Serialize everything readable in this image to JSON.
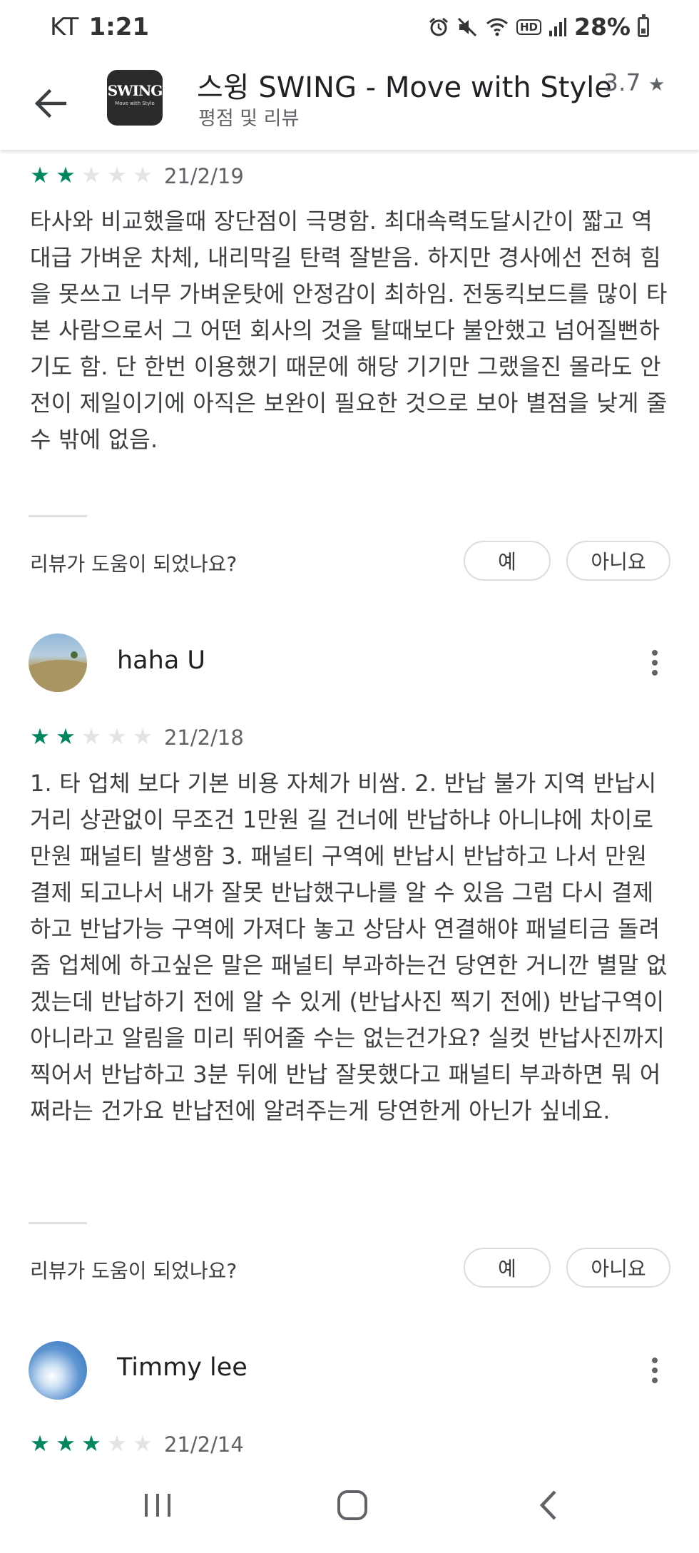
{
  "status_bar": {
    "carrier": "KT",
    "time": "1:21",
    "icons": [
      "alarm-icon",
      "mute-icon",
      "wifi-icon",
      "hd-icon",
      "signal-icon",
      "battery-icon"
    ],
    "hd_label": "HD",
    "battery": "28%"
  },
  "header": {
    "logo_text": "SWING",
    "logo_tagline": "Move with Style",
    "app_title": "스윙 SWING - Move with Style",
    "rating": "3.7",
    "subtitle": "평점 및 리뷰"
  },
  "accent_color": "#01875f",
  "reviews": [
    {
      "rating": 2,
      "date": "21/2/19",
      "text": "타사와 비교했을때 장단점이 극명함. 최대속력도달시간이 짧고 역대급 가벼운 차체, 내리막길 탄력 잘받음. 하지만 경사에선 전혀 힘을 못쓰고 너무 가벼운탓에 안정감이 최하임. 전동킥보드를 많이 타본 사람으로서 그 어떤 회사의 것을 탈때보다 불안했고 넘어질뻔하기도 함. 단 한번 이용했기 때문에 해당 기기만 그랬을진 몰라도 안전이 제일이기에 아직은 보완이 필요한 것으로 보아 별점을 낮게 줄 수 밖에 없음.",
      "helpful_question": "리뷰가 도움이 되었나요?",
      "yes_label": "예",
      "no_label": "아니요"
    },
    {
      "author": "haha U",
      "rating": 2,
      "date": "21/2/18",
      "text": "1. 타 업체 보다 기본 비용 자체가 비쌈. 2. 반납 불가 지역 반납시 거리 상관없이 무조건 1만원 길 건너에 반납하냐 아니냐에 차이로 만원 패널티 발생함 3. 패널티 구역에 반납시 반납하고 나서 만원 결제 되고나서 내가 잘못 반납했구나를 알 수 있음 그럼 다시 결제하고 반납가능 구역에 가져다 놓고 상담사 연결해야 패널티금 돌려줌 업체에 하고싶은 말은 패널티 부과하는건 당연한 거니깐 별말 없겠는데 반납하기 전에 알 수 있게 (반납사진 찍기 전에) 반납구역이 아니라고 알림을 미리 뛰어줄 수는 없는건가요? 실컷 반납사진까지 찍어서 반납하고 3분 뒤에 반납 잘못했다고 패널티 부과하면 뭐 어쩌라는 건가요 반납전에 알려주는게 당연한게 아닌가 싶네요.",
      "helpful_question": "리뷰가 도움이 되었나요?",
      "yes_label": "예",
      "no_label": "아니요"
    },
    {
      "author": "Timmy lee",
      "rating": 3,
      "date": "21/2/14"
    }
  ],
  "nav": {
    "buttons": [
      "recent-apps-icon",
      "home-icon",
      "back-nav-icon"
    ]
  }
}
